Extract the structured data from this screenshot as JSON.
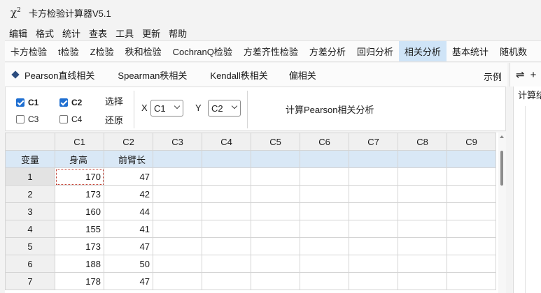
{
  "window": {
    "title": "卡方检验计算器V5.1",
    "icon": "chi-square-icon"
  },
  "menu": [
    "编辑",
    "格式",
    "统计",
    "查表",
    "工具",
    "更新",
    "帮助"
  ],
  "ribbon_tabs": [
    {
      "label": "卡方检验"
    },
    {
      "label": "t检验"
    },
    {
      "label": "Z检验"
    },
    {
      "label": "秩和检验"
    },
    {
      "label": "CochranQ检验"
    },
    {
      "label": "方差齐性检验"
    },
    {
      "label": "方差分析"
    },
    {
      "label": "回归分析"
    },
    {
      "label": "相关分析",
      "active": true
    },
    {
      "label": "基本统计"
    },
    {
      "label": "随机数"
    }
  ],
  "sub_tabs": [
    "Pearson直线相关",
    "Spearman秩相关",
    "Kendall秩相关",
    "偏相关"
  ],
  "example_label": "示例",
  "right_pane": {
    "label": "计算结",
    "swap_icon": "swap-icon",
    "add_icon": "plus-icon"
  },
  "controls": {
    "checkboxes": [
      {
        "label": "C1",
        "checked": true
      },
      {
        "label": "C2",
        "checked": true
      },
      {
        "label": "C3",
        "checked": false
      },
      {
        "label": "C4",
        "checked": false
      }
    ],
    "select_label": "选择",
    "restore_label": "还原",
    "x_label": "X",
    "x_value": "C1",
    "y_label": "Y",
    "y_value": "C2",
    "calc_button": "计算Pearson相关分析"
  },
  "grid": {
    "columns": [
      "C1",
      "C2",
      "C3",
      "C4",
      "C5",
      "C6",
      "C7",
      "C8",
      "C9"
    ],
    "var_label": "变量",
    "var_names": [
      "身高",
      "前臂长"
    ],
    "rows": [
      {
        "n": "1",
        "c1": "170",
        "c2": "47"
      },
      {
        "n": "2",
        "c1": "173",
        "c2": "42"
      },
      {
        "n": "3",
        "c1": "160",
        "c2": "44"
      },
      {
        "n": "4",
        "c1": "155",
        "c2": "41"
      },
      {
        "n": "5",
        "c1": "173",
        "c2": "47"
      },
      {
        "n": "6",
        "c1": "188",
        "c2": "50"
      },
      {
        "n": "7",
        "c1": "178",
        "c2": "47"
      }
    ]
  }
}
